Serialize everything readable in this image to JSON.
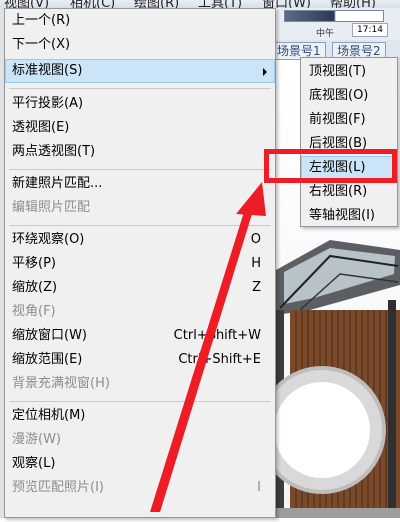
{
  "menubar": [
    "视图(V)",
    "相机(C)",
    "绘图(R)",
    "工具(T)",
    "窗口(W)",
    "帮助(H)"
  ],
  "toolbar": {
    "time_left": "中午",
    "time_value": "17:14"
  },
  "scene_tabs": [
    "场景号1",
    "场景号2"
  ],
  "camera_menu": {
    "items": [
      {
        "label": "上一个(R)",
        "shortcut": "",
        "disabled": false
      },
      {
        "label": "下一个(X)",
        "shortcut": "",
        "disabled": false
      },
      {
        "label": "标准视图(S)",
        "shortcut": "",
        "disabled": false,
        "submenu": true
      },
      {
        "label": "平行投影(A)",
        "shortcut": "",
        "disabled": false
      },
      {
        "label": "透视图(E)",
        "shortcut": "",
        "disabled": false
      },
      {
        "label": "两点透视图(T)",
        "shortcut": "",
        "disabled": false
      },
      {
        "label": "新建照片匹配...",
        "shortcut": "",
        "disabled": false
      },
      {
        "label": "编辑照片匹配",
        "shortcut": "",
        "disabled": true
      },
      {
        "label": "环绕观察(O)",
        "shortcut": "O",
        "disabled": false
      },
      {
        "label": "平移(P)",
        "shortcut": "H",
        "disabled": false
      },
      {
        "label": "缩放(Z)",
        "shortcut": "Z",
        "disabled": false
      },
      {
        "label": "视角(F)",
        "shortcut": "",
        "disabled": true
      },
      {
        "label": "缩放窗口(W)",
        "shortcut": "Ctrl+Shift+W",
        "disabled": false
      },
      {
        "label": "缩放范围(E)",
        "shortcut": "Ctrl+Shift+E",
        "disabled": false
      },
      {
        "label": "背景充满视窗(H)",
        "shortcut": "",
        "disabled": true
      },
      {
        "label": "定位相机(M)",
        "shortcut": "",
        "disabled": false
      },
      {
        "label": "漫游(W)",
        "shortcut": "",
        "disabled": true
      },
      {
        "label": "观察(L)",
        "shortcut": "",
        "disabled": false
      },
      {
        "label": "预览匹配照片(I)",
        "shortcut": "I",
        "disabled": true
      }
    ]
  },
  "standard_views_submenu": {
    "items": [
      "顶视图(T)",
      "底视图(O)",
      "前视图(F)",
      "后视图(B)",
      "左视图(L)",
      "右视图(R)",
      "等轴视图(I)"
    ],
    "highlighted_index": 4
  },
  "colors": {
    "annotation": "#ee1c25",
    "highlight": "#cce4f7"
  }
}
